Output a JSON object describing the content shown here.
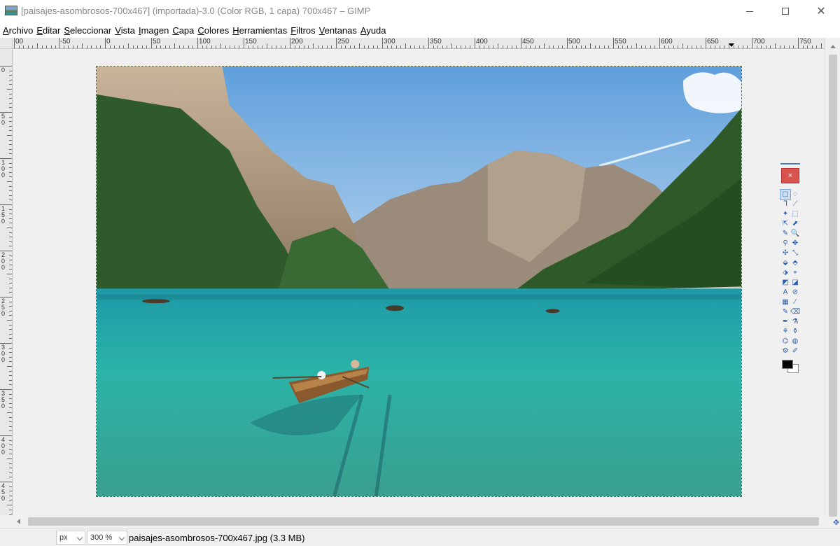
{
  "window": {
    "title": "[paisajes-asombrosos-700x467] (importada)-3.0 (Color RGB, 1 capa) 700x467 – GIMP",
    "app_icon": "gimp-image-icon",
    "controls": {
      "minimize_icon": "minimize-icon",
      "maximize_icon": "maximize-icon",
      "close_icon": "close-icon",
      "close_glyph": "✕"
    }
  },
  "menubar": {
    "items": [
      "Archivo",
      "Editar",
      "Seleccionar",
      "Vista",
      "Imagen",
      "Capa",
      "Colores",
      "Herramientas",
      "Filtros",
      "Ventanas",
      "Ayuda"
    ]
  },
  "ruler_h": {
    "labels": [
      "00",
      "-50",
      "0",
      "50",
      "100",
      "150",
      "200",
      "250",
      "300",
      "350",
      "400",
      "450",
      "500",
      "550",
      "600",
      "650",
      "700",
      "750"
    ]
  },
  "ruler_v": {
    "labels": [
      "0",
      "50",
      "100",
      "150",
      "200",
      "250",
      "300",
      "350",
      "400",
      "450"
    ]
  },
  "canvas": {
    "image_name": "paisajes-asombrosos-700x467.jpg",
    "description_icon": "landscape-photo"
  },
  "toolbox": {
    "close_glyph": "×",
    "tools": [
      "▢",
      "◌",
      "ᒣ",
      "⟋",
      "✦",
      "⬚",
      "⇱",
      "⬈",
      "✎",
      "🔍",
      "⚲",
      "✥",
      "✣",
      "⤡",
      "⬙",
      "⬘",
      "⬗",
      "⌖",
      "◩",
      "◪",
      "A",
      "⊘",
      "▦",
      "∕",
      "✎",
      "⌫",
      "✒",
      "⚗",
      "⚘",
      "⚱",
      "⌬",
      "◍",
      "⚙",
      "✐"
    ],
    "fg_color": "#000000",
    "bg_color": "#ffffff"
  },
  "statusbar": {
    "unit": "px",
    "zoom": "300 %",
    "info": "paisajes-asombrosos-700x467.jpg (3.3 MB)"
  },
  "colors": {
    "sky": "#8fbde8",
    "water": "#2aa6a2",
    "forest": "#2f5a2c",
    "rock": "#b8a58e"
  }
}
